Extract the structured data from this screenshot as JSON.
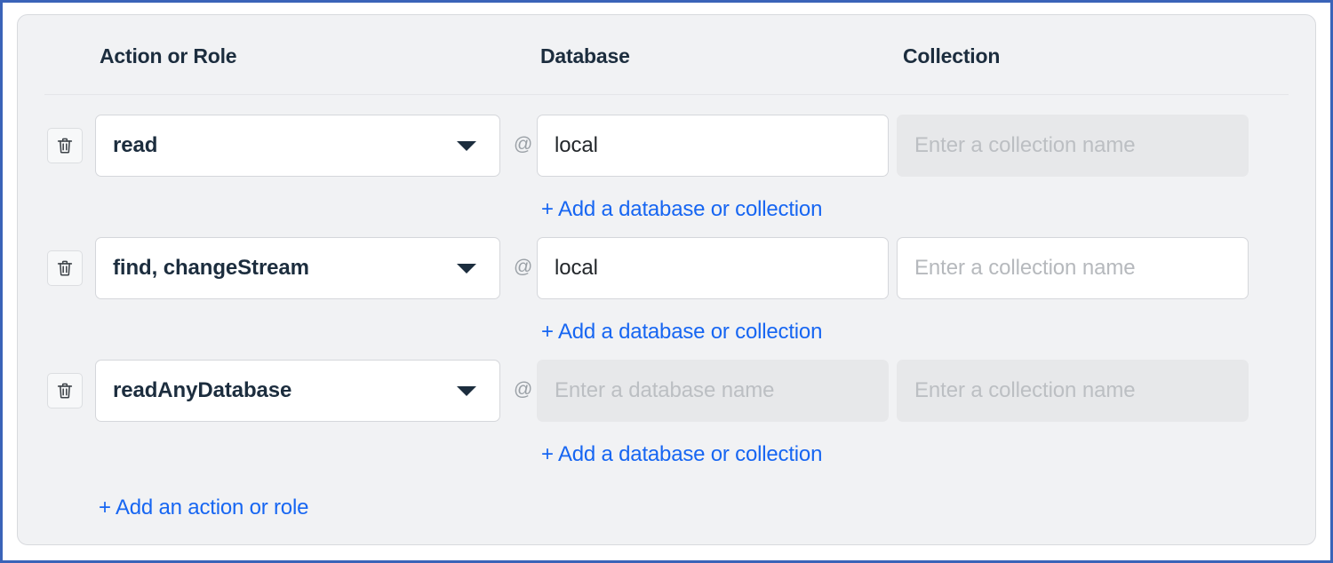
{
  "theme": {
    "accent": "#1766f2",
    "heading_color": "#1c2d3e",
    "card_bg": "#f1f2f4",
    "card_border": "#d8dade",
    "page_frame": "#3a63b8",
    "input_border": "#d5d7db",
    "disabled_bg": "#e7e8ea",
    "placeholder": "#b6b9bd"
  },
  "table": {
    "columns": [
      {
        "key": "action",
        "label": "Action or Role"
      },
      {
        "key": "database",
        "label": "Database"
      },
      {
        "key": "collection",
        "label": "Collection"
      }
    ],
    "separator_symbol": "@",
    "add_row_label": "+ Add an action or role",
    "add_resource_label": "+ Add a database or collection",
    "delete_icon": "trash-icon",
    "dropdown_icon": "chevron-down-icon",
    "rows": [
      {
        "action": {
          "value": "read",
          "enabled": true
        },
        "database": {
          "value": "local",
          "placeholder": "Enter a database name",
          "enabled": true
        },
        "collection": {
          "value": "",
          "placeholder": "Enter a collection name",
          "enabled": false
        },
        "add_resource_label": "+ Add a database or collection"
      },
      {
        "action": {
          "value": "find, changeStream",
          "enabled": true
        },
        "database": {
          "value": "local",
          "placeholder": "Enter a database name",
          "enabled": true
        },
        "collection": {
          "value": "",
          "placeholder": "Enter a collection name",
          "enabled": true
        },
        "add_resource_label": "+ Add a database or collection"
      },
      {
        "action": {
          "value": "readAnyDatabase",
          "enabled": true
        },
        "database": {
          "value": "",
          "placeholder": "Enter a database name",
          "enabled": false
        },
        "collection": {
          "value": "",
          "placeholder": "Enter a collection name",
          "enabled": false
        },
        "add_resource_label": "+ Add a database or collection"
      }
    ]
  }
}
